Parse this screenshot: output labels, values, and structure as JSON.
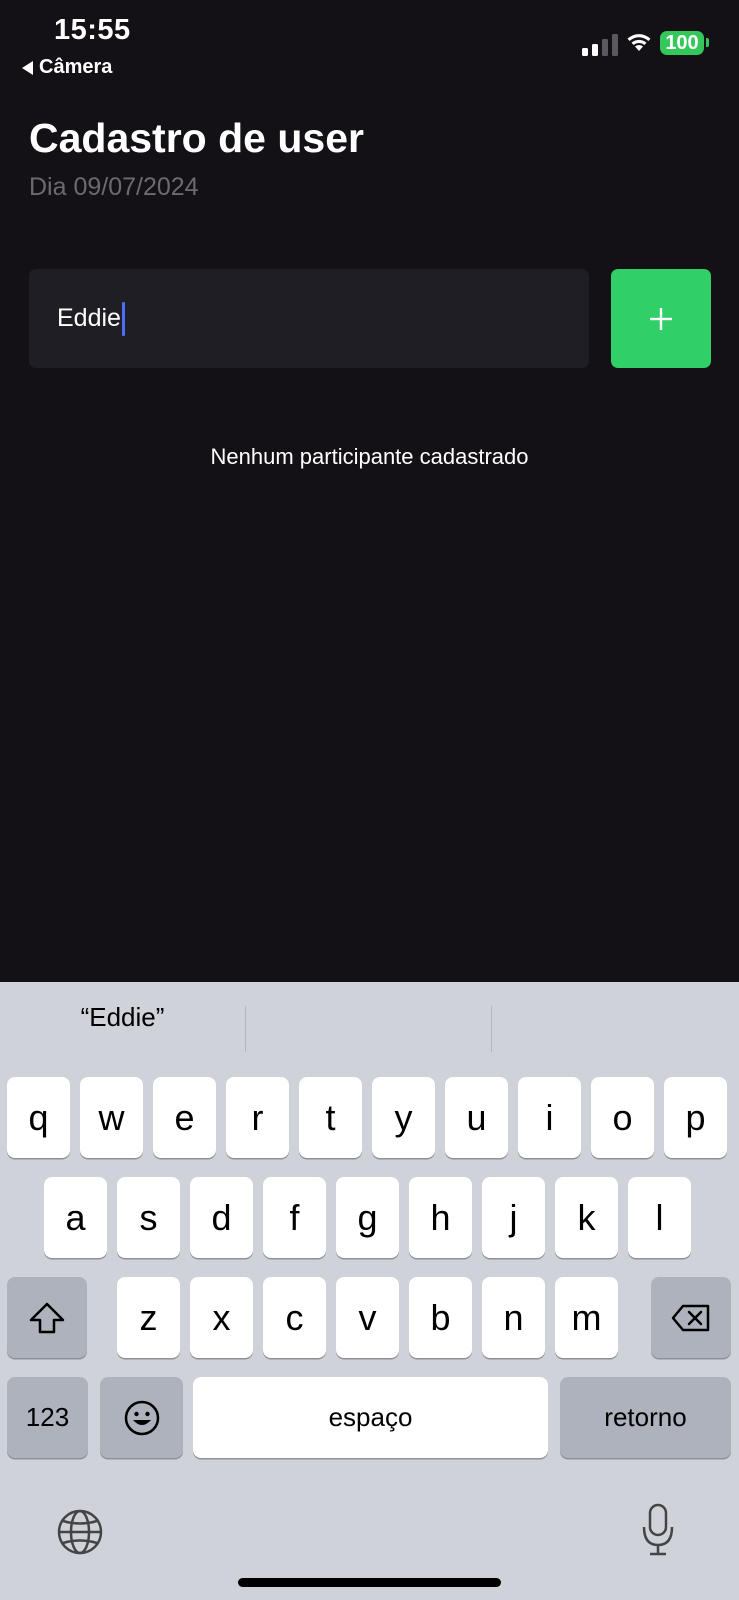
{
  "status_bar": {
    "time": "15:55",
    "back_label": "Câmera",
    "battery": "100",
    "battery_color": "#34c759"
  },
  "header": {
    "title": "Cadastro de user",
    "date": "Dia 09/07/2024"
  },
  "form": {
    "name_value": "Eddie",
    "add_icon": "plus-icon",
    "add_color": "#31cf67"
  },
  "empty_message": "Nenhum participante cadastrado",
  "keyboard": {
    "suggestions": [
      "“Eddie”",
      "",
      ""
    ],
    "row1": [
      "q",
      "w",
      "e",
      "r",
      "t",
      "y",
      "u",
      "i",
      "o",
      "p"
    ],
    "row2": [
      "a",
      "s",
      "d",
      "f",
      "g",
      "h",
      "j",
      "k",
      "l"
    ],
    "row3": [
      "z",
      "x",
      "c",
      "v",
      "b",
      "n",
      "m"
    ],
    "numbers_label": "123",
    "space_label": "espaço",
    "return_label": "retorno",
    "icons": [
      "shift-icon",
      "backspace-icon",
      "emoji-icon",
      "globe-icon",
      "microphone-icon"
    ]
  }
}
